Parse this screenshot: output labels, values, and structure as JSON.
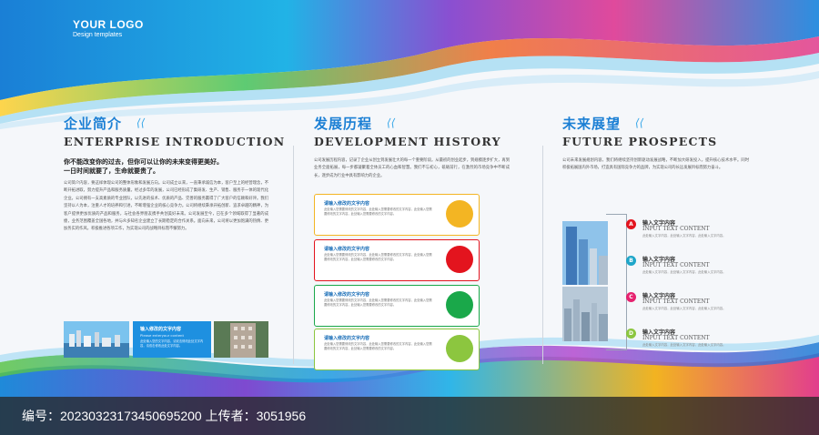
{
  "colors": {
    "accent": "#1b7fd4",
    "heading_dark": "#333333",
    "yellow": "#f3b523",
    "red": "#e3141e",
    "green": "#1aa84a",
    "lime": "#8cc63f",
    "cyan": "#1ea6c9",
    "magenta": "#e6226f"
  },
  "logo": {
    "title": "YOUR LOGO",
    "subtitle": "Design templates"
  },
  "intro": {
    "title_cn": "企业简介",
    "title_en": "ENTERPRISE INTRODUCTION",
    "slogan_line1": "你不能改变你的过去，但你可以让你的未来变得更美好。",
    "slogan_line2": "一日时间就要了，生命就要贵了。",
    "paragraph": "公司简介内容，要这样体现公司的整体形象和发展方向。公司成立以来，一直秉承诚信为本，客户至上的经营理念，不断开拓进取，努力提升产品和服务质量。经过多年的发展，公司已经形成了集研发、生产、销售、服务于一体的现代化企业。公司拥有一支高素质的专业团队，以先进的技术、优质的产品、完善的服务赢得了广大客户的信赖和好评。我们坚持以人为本，注重人才的培养和引进，不断增强企业的核心竞争力。公司将继续秉承开拓创新、追求卓越的精神，为客户提供更加优质的产品和服务，与社会各界朋友携手共创美好未来。公司发展至今，已在多个领域取得了显著的成绩，业务范围覆盖全国各地，并与众多知名企业建立了长期稳定的合作关系。面向未来，公司将以更加饱满的热情、更加务实的作风，积极推进各项工作，为实现公司的战略目标而不懈努力。",
    "banner_title": "输入修改的文字内容",
    "banner_sub": "Please enteryour content",
    "banner_text": "此处输入您的文字内容，请双击修改此处文字内容，请双击修改此处文字内容。"
  },
  "history": {
    "title_cn": "发展历程",
    "title_en": "DEVELOPMENT HISTORY",
    "paragraph": "公司发展历程内容，记录了企业从创立到发展壮大的每一个重要阶段。从最初的创业起步，到规模逐步扩大，再到业务全面拓展，每一步都凝聚着全体员工的心血和智慧。我们不忘初心，砥砺前行，在激烈的市场竞争中不断成长，逐步成为行业中具有影响力的企业。",
    "cards": [
      {
        "title": "请输入修改的文字内容",
        "text": "此处输入您需要修改的文字内容，此处输入您需要修改的文字内容，此处输入您需要修改的文字内容，此处输入您需要修改的文字内容。"
      },
      {
        "title": "请输入修改的文字内容",
        "text": "此处输入您需要修改的文字内容，此处输入您需要修改的文字内容，此处输入您需要修改的文字内容，此处输入您需要修改的文字内容。"
      },
      {
        "title": "请输入修改的文字内容",
        "text": "此处输入您需要修改的文字内容，此处输入您需要修改的文字内容，此处输入您需要修改的文字内容，此处输入您需要修改的文字内容。"
      },
      {
        "title": "请输入修改的文字内容",
        "text": "此处输入您需要修改的文字内容，此处输入您需要修改的文字内容，此处输入您需要修改的文字内容，此处输入您需要修改的文字内容。"
      }
    ]
  },
  "future": {
    "title_cn": "未来展望",
    "title_en": "FUTURE PROSPECTS",
    "paragraph": "公司未来发展规划内容，我们将继续坚持创新驱动发展战略，不断加大研发投入，提升核心技术水平。同时积极拓展国内外市场，打造具有国际竞争力的品牌，为实现公司的长远发展目标而努力奋斗。",
    "items": [
      {
        "letter": "A",
        "title": "输入文字内容",
        "en": "INPUT TEXT CONTENT",
        "text": "此处输入文字内容，此处输入文字内容，此处输入文字内容。"
      },
      {
        "letter": "B",
        "title": "输入文字内容",
        "en": "INPUT TEXT CONTENT",
        "text": "此处输入文字内容，此处输入文字内容，此处输入文字内容。"
      },
      {
        "letter": "C",
        "title": "输入文字内容",
        "en": "INPUT TEXT CONTENT",
        "text": "此处输入文字内容，此处输入文字内容，此处输入文字内容。"
      },
      {
        "letter": "D",
        "title": "输入文字内容",
        "en": "INPUT TEXT CONTENT",
        "text": "此处输入文字内容，此处输入文字内容，此处输入文字内容。"
      }
    ]
  },
  "footer": {
    "text": "编号：20230323173450695200  上传者：3051956"
  }
}
